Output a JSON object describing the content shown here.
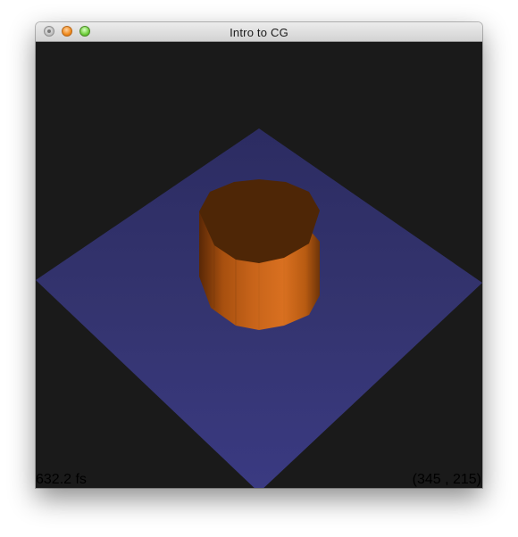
{
  "window": {
    "title": "Intro to CG",
    "controls": [
      "close-icon",
      "minimize-icon",
      "zoom-icon"
    ]
  },
  "viewport": {
    "background_color": "#1a1a1a",
    "plane_color": "#3a3a86",
    "cylinder_color": "#c8641a",
    "fps_text": "632.2 fs",
    "mouse_coords_text": "(345 , 215)"
  }
}
